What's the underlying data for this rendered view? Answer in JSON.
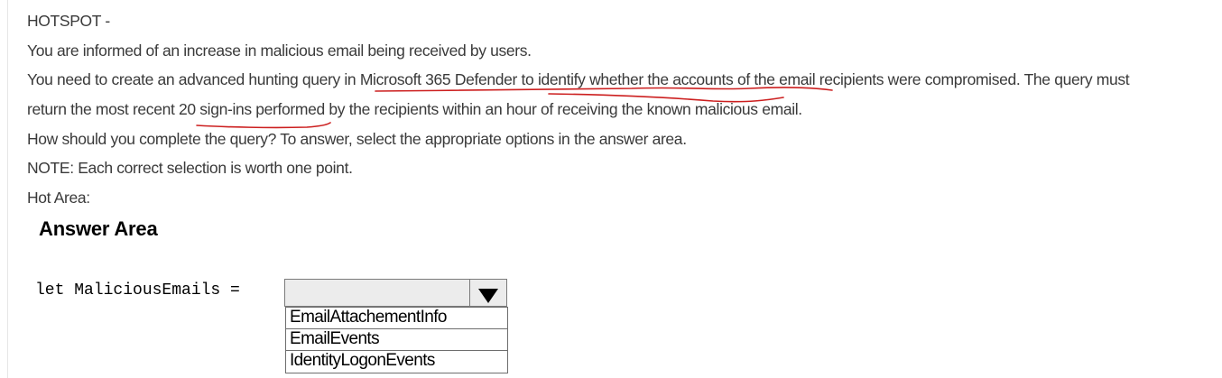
{
  "question": {
    "heading": "HOTSPOT -",
    "paragraphs": [
      "You are informed of an increase in malicious email being received by users.",
      "You need to create an advanced hunting query in Microsoft 365 Defender to identify whether the accounts of the email recipients were compromised. The query must",
      "return the most recent 20 sign-ins performed by the recipients within an hour of receiving the known malicious email.",
      "How should you complete the query? To answer, select the appropriate options in the answer area.",
      "NOTE: Each correct selection is worth one point.",
      "Hot Area:"
    ],
    "annotation_color": "#cc1f1f"
  },
  "answer_area": {
    "title": "Answer Area",
    "code_label": "let MaliciousEmails =",
    "dropdown": {
      "selected": "",
      "options": [
        "EmailAttachementInfo",
        "EmailEvents",
        "IdentityLogonEvents"
      ]
    }
  }
}
